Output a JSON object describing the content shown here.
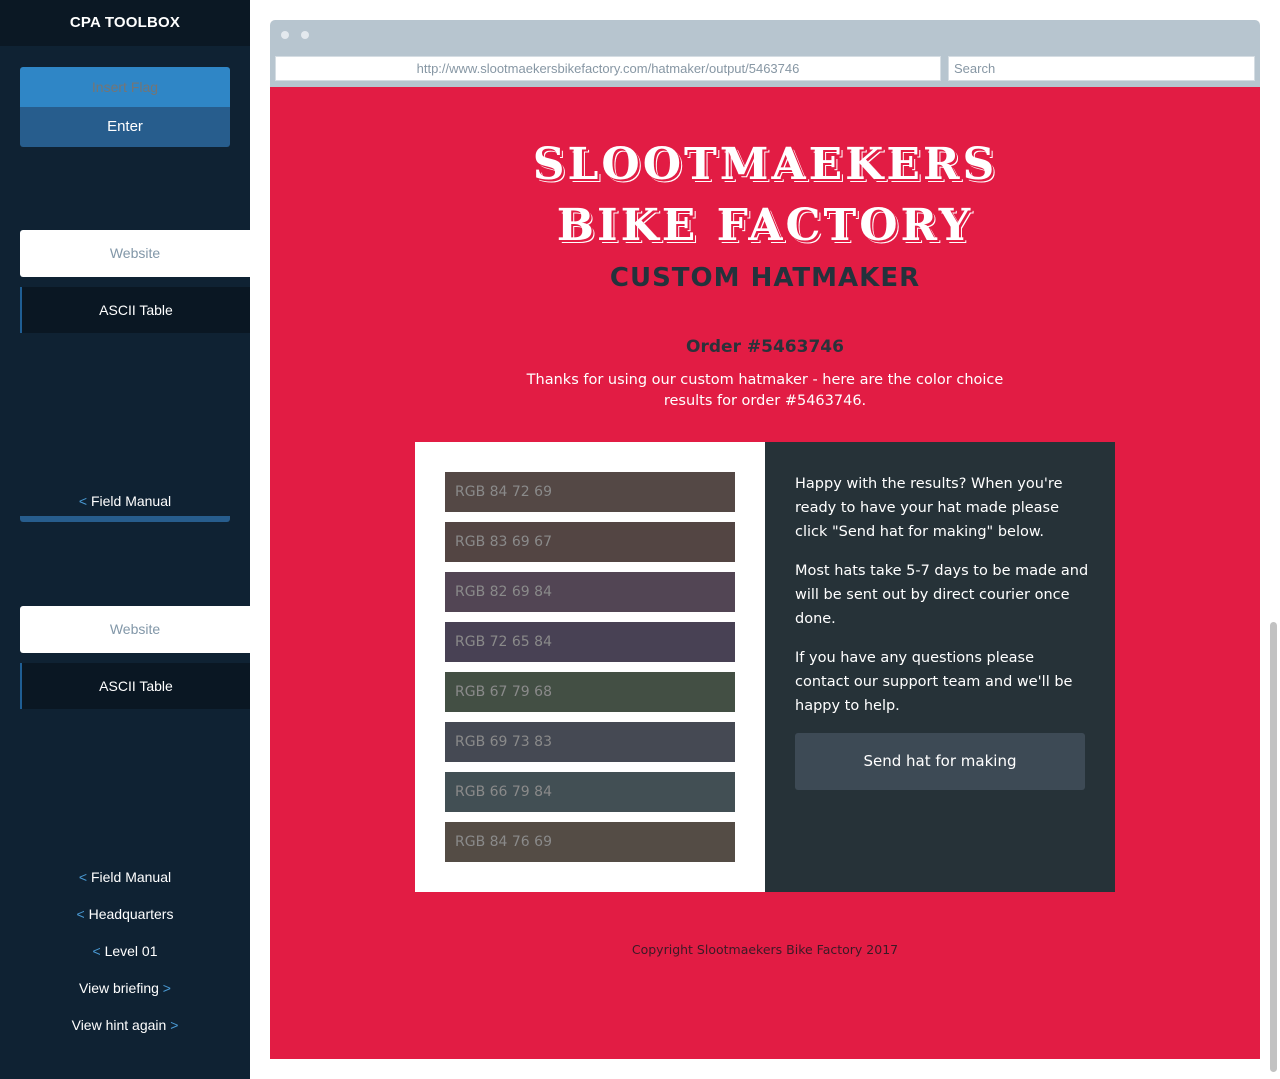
{
  "sidebar": {
    "title": "CPA TOOLBOX",
    "flag_placeholder": "Insert Flag",
    "enter_label": "Enter",
    "tabs_top": {
      "website": "Website",
      "ascii": "ASCII Table"
    },
    "field_manual_top": "Field Manual",
    "tabs_bottom": {
      "website": "Website",
      "ascii": "ASCII Table"
    },
    "nav": {
      "field_manual": "Field Manual",
      "headquarters": "Headquarters",
      "level": "Level 01",
      "view_briefing": "View briefing",
      "view_hint": "View hint again"
    },
    "arrow_left": "<",
    "arrow_right": ">"
  },
  "browser": {
    "url": "http://www.slootmaekersbikefactory.com/hatmaker/output/5463746",
    "search_placeholder": "Search"
  },
  "page": {
    "logo_line1": "SLOOTMAEKERS",
    "logo_line2": "BIKE FACTORY",
    "logo_line3": "CUSTOM HATMAKER",
    "order_title": "Order #5463746",
    "order_text": "Thanks for using our custom hatmaker - here are the color choice results for order #5463746.",
    "swatches": [
      {
        "label": "RGB 84 72 69",
        "color": "#544845"
      },
      {
        "label": "RGB 83 69 67",
        "color": "#534543"
      },
      {
        "label": "RGB 82 69 84",
        "color": "#524554"
      },
      {
        "label": "RGB 72 65 84",
        "color": "#484154"
      },
      {
        "label": "RGB 67 79 68",
        "color": "#434f44"
      },
      {
        "label": "RGB 69 73 83",
        "color": "#454953"
      },
      {
        "label": "RGB 66 79 84",
        "color": "#424f54"
      },
      {
        "label": "RGB 84 76 69",
        "color": "#544c45"
      }
    ],
    "info_p1": "Happy with the results? When you're ready to have your hat made please click \"Send hat for making\" below.",
    "info_p2": "Most hats take 5-7 days to be made and will be sent out by direct courier once done.",
    "info_p3": "If you have any questions please contact our support team and we'll be happy to help.",
    "send_button": "Send hat for making",
    "copyright": "Copyright Slootmaekers Bike Factory 2017"
  },
  "colors": {
    "page_bg": "#e21c44",
    "sidebar_bg": "#0f2233",
    "info_panel_bg": "#263238",
    "accent_blue": "#2f86c6"
  }
}
